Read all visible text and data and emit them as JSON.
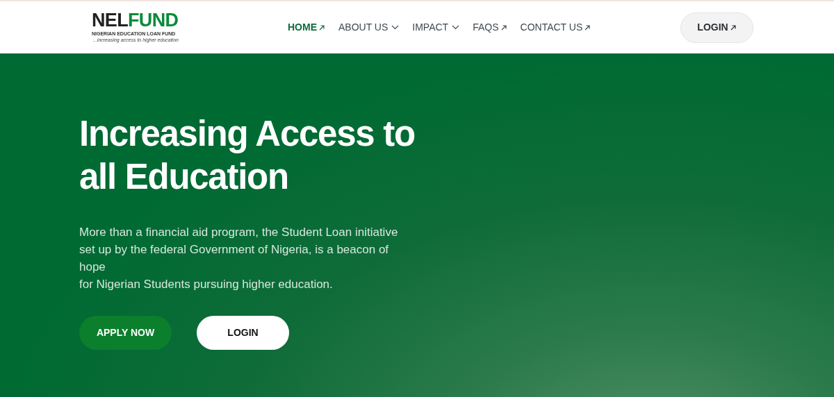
{
  "logo": {
    "part_1": "NEL",
    "part_2": "FUND",
    "subtitle": "NIGERIAN EDUCATION LOAN FUND",
    "tagline": "...increasing access to higher education"
  },
  "nav": [
    {
      "label": "HOME",
      "kind": "link",
      "selected": true
    },
    {
      "label": "ABOUT US",
      "kind": "dropdown",
      "selected": false
    },
    {
      "label": "IMPACT",
      "kind": "dropdown",
      "selected": false
    },
    {
      "label": "FAQS",
      "kind": "link",
      "selected": false
    },
    {
      "label": "CONTACT US",
      "kind": "link",
      "selected": false
    }
  ],
  "login_button": "LOGIN",
  "hero": {
    "heading_line_1": "Increasing Access to",
    "heading_line_2": "all Education",
    "paragraph_lines": [
      "More than a financial aid program, the Student Loan initiative",
      "set up by the federal Government of Nigeria, is a beacon of",
      "hope",
      "for Nigerian Students pursuing higher education."
    ],
    "buttons": [
      {
        "label": "APPLY NOW",
        "kind": "primary"
      },
      {
        "label": "LOGIN",
        "kind": "secondary"
      }
    ]
  }
}
